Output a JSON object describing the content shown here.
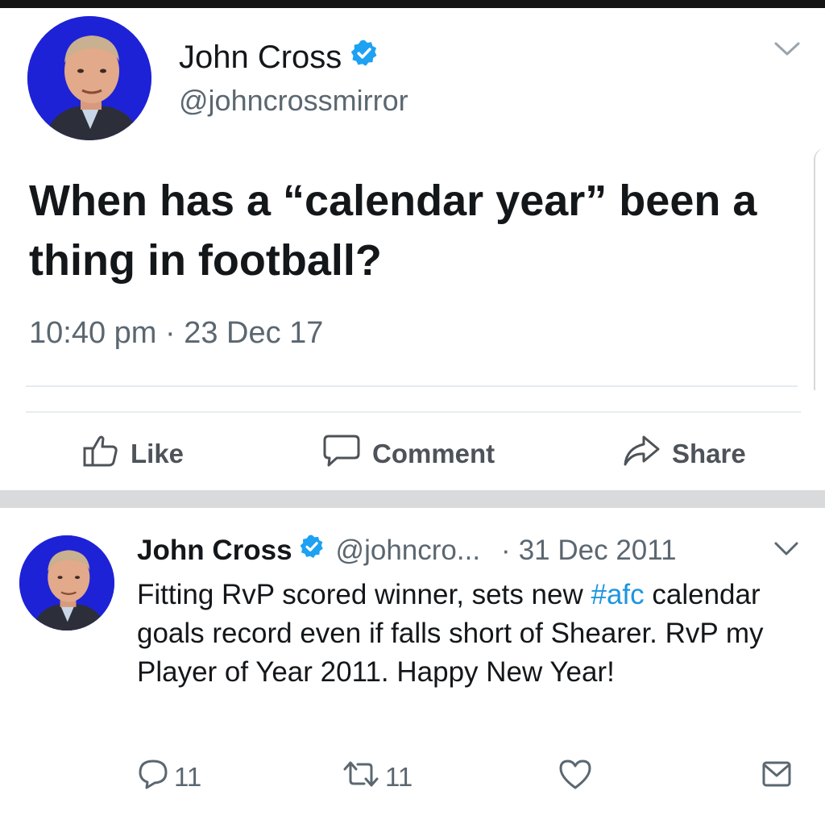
{
  "main_tweet": {
    "author_name": "John Cross",
    "handle": "@johncrossmirror",
    "text": "When has a “calendar year” been a thing in football?",
    "timestamp": "10:40 pm · 23 Dec 17",
    "actions": {
      "like": "Like",
      "comment": "Comment",
      "share": "Share"
    }
  },
  "quoted_tweet": {
    "author_name": "John Cross",
    "handle": "@johncro...",
    "separator": "·",
    "date": "31 Dec 2011",
    "text_before": "Fitting RvP scored winner, sets new ",
    "hashtag": "#afc",
    "text_after": " calendar goals record even if falls short of Shearer. RvP my Player of Year 2011. Happy New Year!",
    "reply_count": "11",
    "retweet_count": "11"
  },
  "colors": {
    "verified_badge": "#1da1f2",
    "hashtag": "#1b95e0",
    "avatar_background": "#1e22d6"
  },
  "icons": {
    "verified": "verified-badge-icon",
    "chevron": "chevron-down-icon",
    "like": "thumbs-up-icon",
    "comment": "speech-bubble-icon",
    "share": "share-arrow-icon",
    "reply": "reply-icon",
    "retweet": "retweet-icon",
    "heart": "heart-icon",
    "dm": "envelope-icon"
  }
}
